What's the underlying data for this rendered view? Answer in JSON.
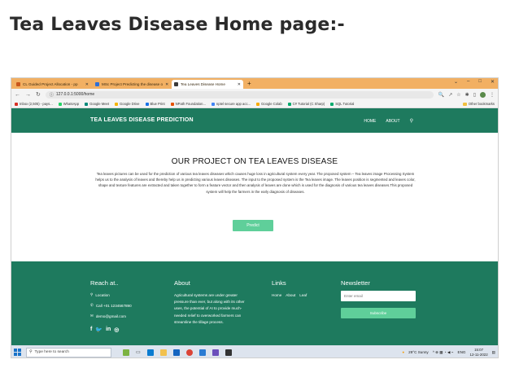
{
  "doc": {
    "heading": "Tea Leaves Disease Home page:-"
  },
  "browser": {
    "tabs": [
      {
        "label": "CL Guided Project Allocation - pp",
        "active": false
      },
      {
        "label": "MSc Project Predicting the disease o",
        "active": false
      },
      {
        "label": "Tea Leaves Disease Home",
        "active": true
      }
    ],
    "new_tab": "+",
    "url": "127.0.0.1:5000/home",
    "bookmarks": [
      "Inbox (2,505) - pays...",
      "WhatsApp",
      "Google Meet",
      "Google Drive",
      "Blue Print",
      "NPath Foundation...",
      "nptel secure app acc...",
      "Google Colab",
      "C# Tutorial (C Sharp)",
      "SQL Tutorial"
    ],
    "other_bookmarks": "Other bookmarks"
  },
  "site": {
    "brand": "TEA LEAVES DISEASE PREDICTION",
    "nav": {
      "home": "HOME",
      "about": "ABOUT"
    },
    "project": {
      "title": "OUR PROJECT ON TEA LEAVES DISEASE",
      "text": "Tea leaves pictures can be used for the prediction of various tea leaves diseases which causes huge loss in agricultural system every year. The proposed system – Tea leaves image Processing System helps us to the analysis of leaves and thereby help us in predicting various leaves diseases. The input to the proposed system is the Tea leaves image. The leaves position is segmented and leaves color, shape and texture features are extracted and taken together to form a feature vector and then analysis of leaves are done which is used for the diagnosis of various tea leaves diseases.This proposed system will help the farmers in the early diagnosis of diseases.",
      "predict_label": "Predict"
    },
    "footer": {
      "reach": {
        "heading": "Reach at..",
        "location": "Location",
        "phone": "Call +01 1234567890",
        "email": "demo@gmail.com"
      },
      "about": {
        "heading": "About",
        "text": "Agricultural systems are under greater pressure than ever, but along with its other uses, the potential of AI to provide much-needed relief to overworked farmers can streamline the tillage process."
      },
      "links": {
        "heading": "Links",
        "items": [
          "Home",
          "About",
          "Leaf"
        ]
      },
      "newsletter": {
        "heading": "Newsletter",
        "placeholder": "Enter email",
        "subscribe_label": "Subscribe"
      }
    }
  },
  "taskbar": {
    "search_placeholder": "Type here to search",
    "weather": "29°C Sunny",
    "lang": "ENG",
    "time": "15:07",
    "date": "12-11-2022"
  },
  "colors": {
    "brand_green": "#1e7a5e",
    "button_green": "#5fcf9a",
    "tab_bar": "#f2b063"
  }
}
